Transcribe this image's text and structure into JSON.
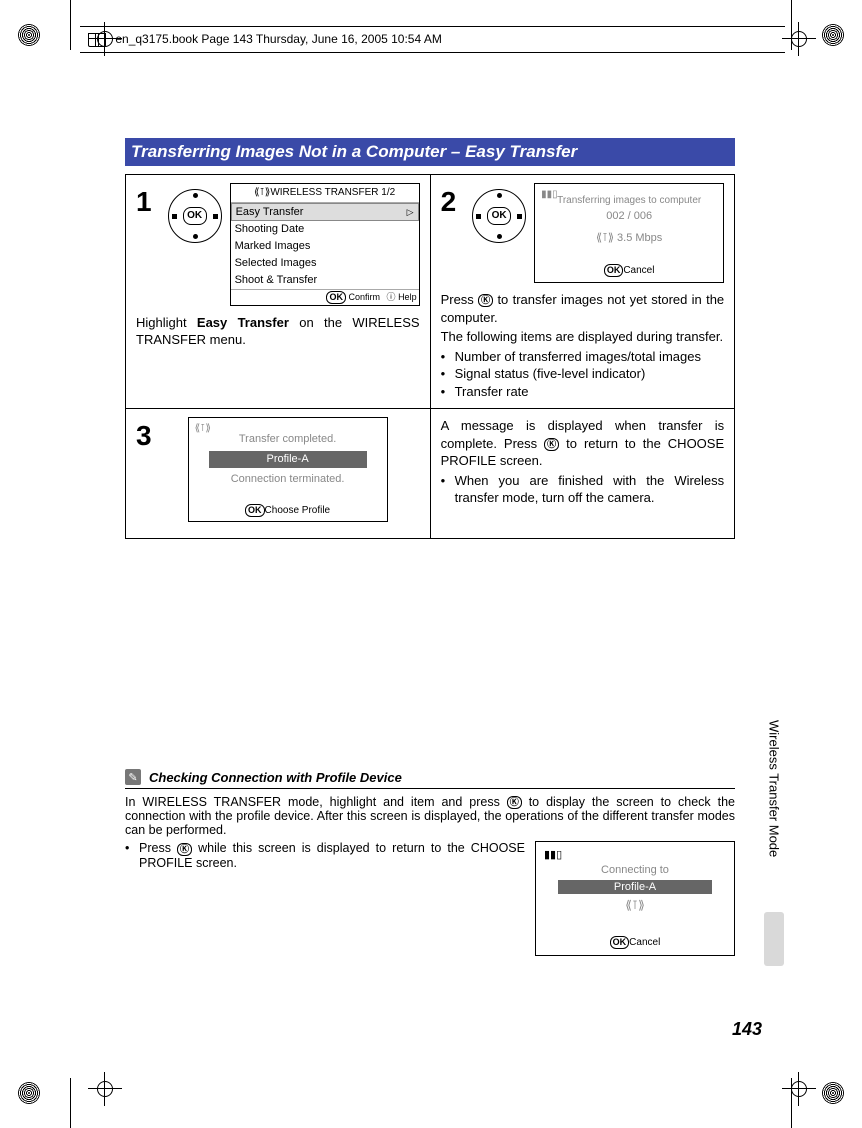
{
  "header": {
    "text": "en_q3175.book  Page 143  Thursday, June 16, 2005  10:54 AM"
  },
  "title": "Transferring Images Not in a Computer – Easy Transfer",
  "step1": {
    "num": "1",
    "lcd_title": "WIRELESS TRANSFER 1/2",
    "items": [
      "Easy Transfer",
      "Shooting Date",
      "Marked Images",
      "Selected Images",
      "Shoot & Transfer"
    ],
    "foot_confirm": "Confirm",
    "foot_help": "Help",
    "ok_label": "OK",
    "desc_a": "Highlight ",
    "desc_bold": "Easy Transfer",
    "desc_b": " on the WIRELESS TRANSFER menu."
  },
  "step2": {
    "num": "2",
    "ok_label": "OK",
    "lcd": {
      "signal": "▮▮▯",
      "line1": "Transferring images to computer",
      "count": "002 /  006",
      "antenna": "⟪⊺⟫",
      "rate": "3.5 Mbps",
      "cancel_prefix": "Ⓚ",
      "cancel": "Cancel"
    },
    "desc_a": "Press ",
    "desc_b": " to transfer images not yet stored in the computer.",
    "desc_c": "The following items are displayed during transfer.",
    "bullets": [
      "Number of transferred images/total images",
      "Signal status (five-level indicator)",
      "Transfer rate"
    ]
  },
  "step3": {
    "num": "3",
    "lcd": {
      "antenna": "⟪⊺⟫",
      "msg1": "Transfer completed.",
      "profile": "Profile-A",
      "msg2": "Connection terminated.",
      "foot_prefix": "Ⓚ",
      "foot": "Choose Profile"
    },
    "desc_a": "A message is displayed when transfer is complete. Press ",
    "desc_b": " to return to the CHOOSE PROFILE screen.",
    "bullet": "When you are finished with the Wireless transfer mode, turn off the camera."
  },
  "note": {
    "icon": "✎",
    "title": "Checking Connection with Profile Device",
    "body_a": "In WIRELESS TRANSFER mode, highlight and item and press ",
    "body_b": " to display the screen to check the connection with the profile device. After this screen is displayed, the operations of the different transfer modes can be performed.",
    "bullet_a": "Press ",
    "bullet_b": " while this screen is displayed to return to the CHOOSE PROFILE screen.",
    "lcd": {
      "signal": "▮▮▯",
      "msg1": "Connecting to",
      "profile": "Profile-A",
      "antenna": "⟪⊺⟫",
      "cancel_prefix": "Ⓚ",
      "cancel": "Cancel"
    }
  },
  "side_label": "Wireless Transfer Mode",
  "page_number": "143",
  "ok_symbol": "Ⓚ"
}
